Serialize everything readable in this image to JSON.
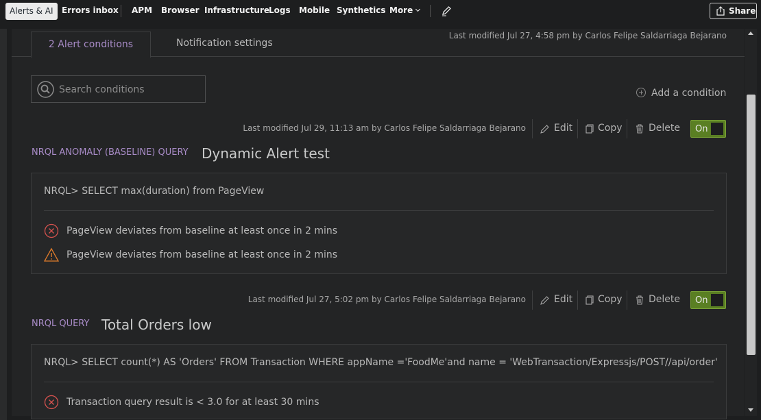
{
  "nav": {
    "active": "Alerts & AI",
    "items": [
      "Errors inbox",
      "APM",
      "Browser",
      "Infrastructure",
      "Logs",
      "Mobile",
      "Synthetics"
    ],
    "more": "More",
    "share": "Share"
  },
  "tabs": {
    "conditions": "2 Alert conditions",
    "notifications": "Notification settings"
  },
  "policy_modified": "Last modified Jul 27, 4:58 pm by Carlos Felipe Saldarriaga Bejarano",
  "search": {
    "placeholder": "Search conditions"
  },
  "add_condition": "Add a condition",
  "actions": {
    "edit": "Edit",
    "copy": "Copy",
    "delete": "Delete",
    "toggle": "On"
  },
  "conditions": [
    {
      "modified": "Last modified Jul 29, 11:13 am by Carlos Felipe Saldarriaga Bejarano",
      "type": "NRQL ANOMALY (BASELINE) QUERY",
      "name": "Dynamic Alert test",
      "query": "NRQL> SELECT max(duration) from PageView",
      "critical": "PageView deviates from baseline at least once in 2 mins",
      "warning": "PageView deviates from baseline at least once in 2 mins",
      "enabled": true
    },
    {
      "modified": "Last modified Jul 27, 5:02 pm by Carlos Felipe Saldarriaga Bejarano",
      "type": "NRQL QUERY",
      "name": "Total Orders low",
      "query": "NRQL> SELECT count(*) AS 'Orders' FROM Transaction WHERE appName ='FoodMe'and name = 'WebTransaction/Expressjs/POST//api/order'",
      "critical": "Transaction query result is < 3.0 for at least 30 mins",
      "enabled": true
    }
  ],
  "colors": {
    "accent_purple": "#a98cc8",
    "toggle_green": "#5a7f23",
    "critical_red": "#d9534f",
    "warning_orange": "#e07b2a"
  }
}
